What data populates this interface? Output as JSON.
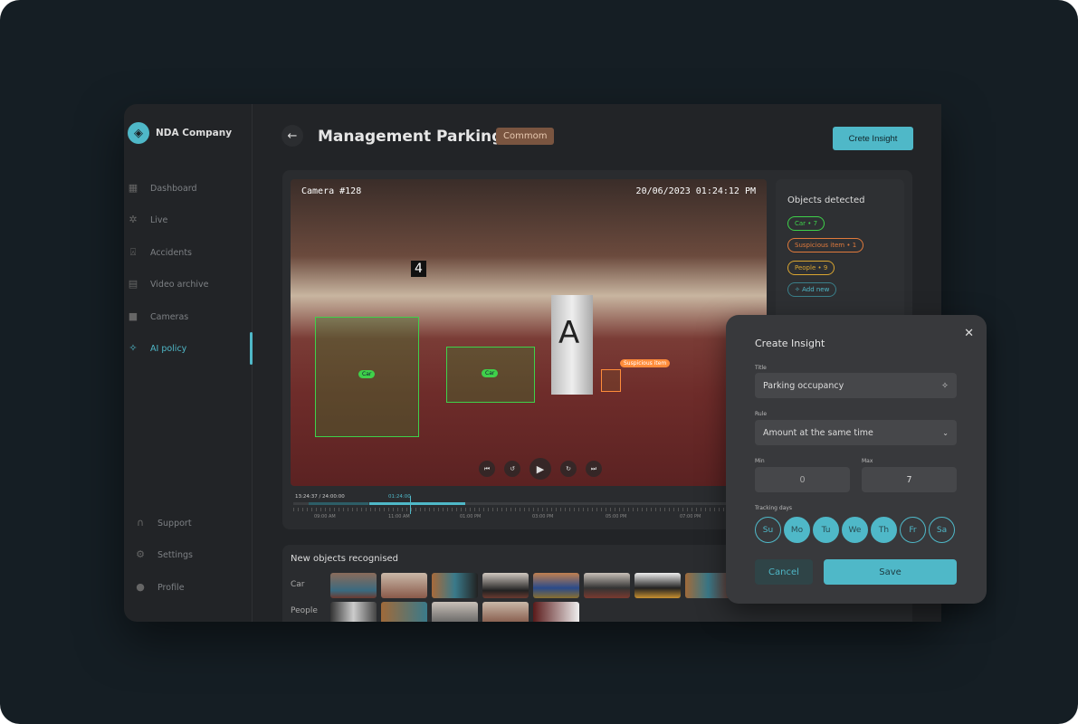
{
  "sidebar": {
    "company": "NDA Company",
    "items": [
      {
        "label": "Dashboard",
        "icon": "dashboard-icon"
      },
      {
        "label": "Live",
        "icon": "live-icon"
      },
      {
        "label": "Accidents",
        "icon": "siren-icon"
      },
      {
        "label": "Video archive",
        "icon": "archive-icon"
      },
      {
        "label": "Cameras",
        "icon": "camera-icon"
      },
      {
        "label": "AI policy",
        "icon": "magic-wand-icon",
        "active": true
      }
    ],
    "bottom": [
      {
        "label": "Support",
        "icon": "headset-icon"
      },
      {
        "label": "Settings",
        "icon": "gear-icon"
      },
      {
        "label": "Profile",
        "icon": "user-icon"
      }
    ]
  },
  "header": {
    "title": "Management Parking",
    "tag": "Commom",
    "cta": "Crete Insight"
  },
  "video": {
    "camera": "Camera #128",
    "timestamp": "20/06/2023   01:24:12 PM",
    "detections": [
      {
        "label": "Car"
      },
      {
        "label": "Car"
      },
      {
        "label": "Suspicious item"
      }
    ],
    "timeline": {
      "elapsed": "13:24:37 / 24:00:00",
      "marker": "01:24:00",
      "labels": [
        "09:00 AM",
        "11:00 AM",
        "01:00 PM",
        "03:00 PM",
        "05:00 PM",
        "07:00 PM"
      ]
    }
  },
  "objects": {
    "title": "Objects detected",
    "chips": [
      {
        "label": "Car • 7",
        "color": "#3fd14a"
      },
      {
        "label": "Suspicious item • 1",
        "color": "#e07a3c"
      },
      {
        "label": "People • 9",
        "color": "#d9a531"
      }
    ],
    "add": "Add new"
  },
  "recognised": {
    "title": "New objects recognised",
    "rows": [
      "Car",
      "People"
    ]
  },
  "modal": {
    "title": "Create Insight",
    "title_label": "Title",
    "title_value": "Parking occupancy",
    "rule_label": "Rule",
    "rule_value": "Amount at the same time",
    "min_label": "Min",
    "min_value": "0",
    "max_label": "Max",
    "max_value": "7",
    "days_label": "Tracking days",
    "days": [
      {
        "d": "Su",
        "on": false
      },
      {
        "d": "Mo",
        "on": true
      },
      {
        "d": "Tu",
        "on": true
      },
      {
        "d": "We",
        "on": true
      },
      {
        "d": "Th",
        "on": true
      },
      {
        "d": "Fr",
        "on": false
      },
      {
        "d": "Sa",
        "on": false
      }
    ],
    "cancel": "Cancel",
    "save": "Save"
  },
  "colors": {
    "accent": "#4fb8c8",
    "tag": "#7a5540"
  }
}
